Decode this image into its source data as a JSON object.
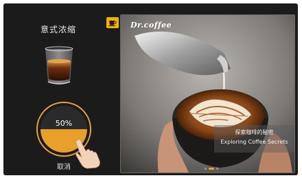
{
  "left_panel": {
    "drink_name": "意式浓缩",
    "progress_text": "50%",
    "progress_fraction": 0.5,
    "cancel_label": "取消"
  },
  "promo": {
    "brand": "Dr.coffee",
    "caption_cn": "探索咖啡的秘密",
    "caption_en": "Exploring Coffee Secrets",
    "slide_count": 3,
    "active_slide": 1
  },
  "colors": {
    "accent": "#e8a02a",
    "button": "#f3b400",
    "background": "#1b1b1b"
  },
  "icons": {
    "drink": "espresso-cup-icon",
    "hand": "hand-pointer-icon",
    "toggle": "coffee-cup-icon"
  }
}
